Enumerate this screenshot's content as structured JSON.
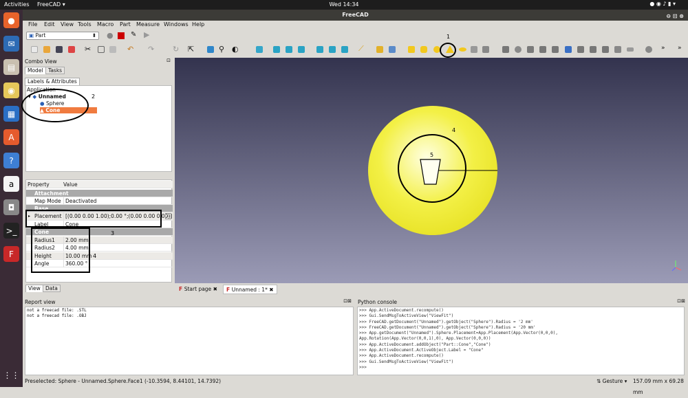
{
  "topbar": {
    "activities": "Activities",
    "app_menu": "FreeCAD ▾",
    "clock": "Wed 14:34"
  },
  "window": {
    "title": "FreeCAD"
  },
  "menu": [
    "File",
    "Edit",
    "View",
    "Tools",
    "Macro",
    "Part",
    "Measure",
    "Windows",
    "Help"
  ],
  "workbench": {
    "selected": "Part"
  },
  "combo": {
    "title": "Combo View",
    "tabs": [
      "Model",
      "Tasks"
    ],
    "labels_tab": "Labels & Attributes",
    "tree": {
      "root": "Application",
      "document": "Unnamed",
      "items": [
        "Sphere",
        "Cone"
      ]
    }
  },
  "properties": {
    "header": {
      "property": "Property",
      "value": "Value"
    },
    "rows": [
      {
        "type": "group",
        "key": "Attachment"
      },
      {
        "key": "Map Mode",
        "value": "Deactivated"
      },
      {
        "type": "group",
        "key": "Base"
      },
      {
        "key": "Placement",
        "value": "[(0.00 0.00 1.00);0.00 °;(0.00 0.00 0.00)]"
      },
      {
        "key": "Label",
        "value": "Cone"
      },
      {
        "type": "group",
        "key": "Cone"
      },
      {
        "key": "Radius1",
        "value": "2.00 mm"
      },
      {
        "key": "Radius2",
        "value": "4.00 mm"
      },
      {
        "key": "Height",
        "value": "10.00 mm"
      },
      {
        "key": "Angle",
        "value": "360.00 °"
      }
    ],
    "bottom_tabs": [
      "View",
      "Data"
    ]
  },
  "view_tabs": [
    {
      "label": "Start page"
    },
    {
      "label": "Unnamed : 1*"
    }
  ],
  "annotations": [
    "1",
    "2",
    "3",
    "4",
    "4",
    "5"
  ],
  "report": {
    "title": "Report view",
    "lines": [
      "not a freecad file: .STL",
      "not a freecad file: .OBJ"
    ]
  },
  "python": {
    "title": "Python console",
    "lines": [
      ">>> App.ActiveDocument.recompute()",
      ">>> Gui.SendMsgToActiveView(\"ViewFit\")",
      ">>> FreeCAD.getDocument(\"Unnamed\").getObject(\"Sphere\").Radius = '2 mm'",
      ">>> FreeCAD.getDocument(\"Unnamed\").getObject(\"Sphere\").Radius = '20 mm'",
      ">>> App.getDocument(\"Unnamed\").Sphere.Placement=App.Placement(App.Vector(0,0,0),",
      "App.Rotation(App.Vector(0,0,1),0), App.Vector(0,0,0))",
      ">>> App.ActiveDocument.addObject(\"Part::Cone\",\"Cone\")",
      ">>> App.ActiveDocument.ActiveObject.Label = \"Cone\"",
      ">>> App.ActiveDocument.recompute()",
      ">>> Gui.SendMsgToActiveView(\"ViewFit\")",
      ">>>"
    ]
  },
  "status": {
    "text": "Preselected: Sphere - Unnamed.Sphere.Face1 (-10.3594, 8.44101, 14.7392)",
    "nav": "Gesture ▾",
    "dims": "157.09 mm x 69.28 mm"
  },
  "colors": {
    "sphere": "#f3f046",
    "selected_row": "#f07b3f",
    "view_top": "#33334e",
    "view_bottom": "#9b9bb6"
  }
}
